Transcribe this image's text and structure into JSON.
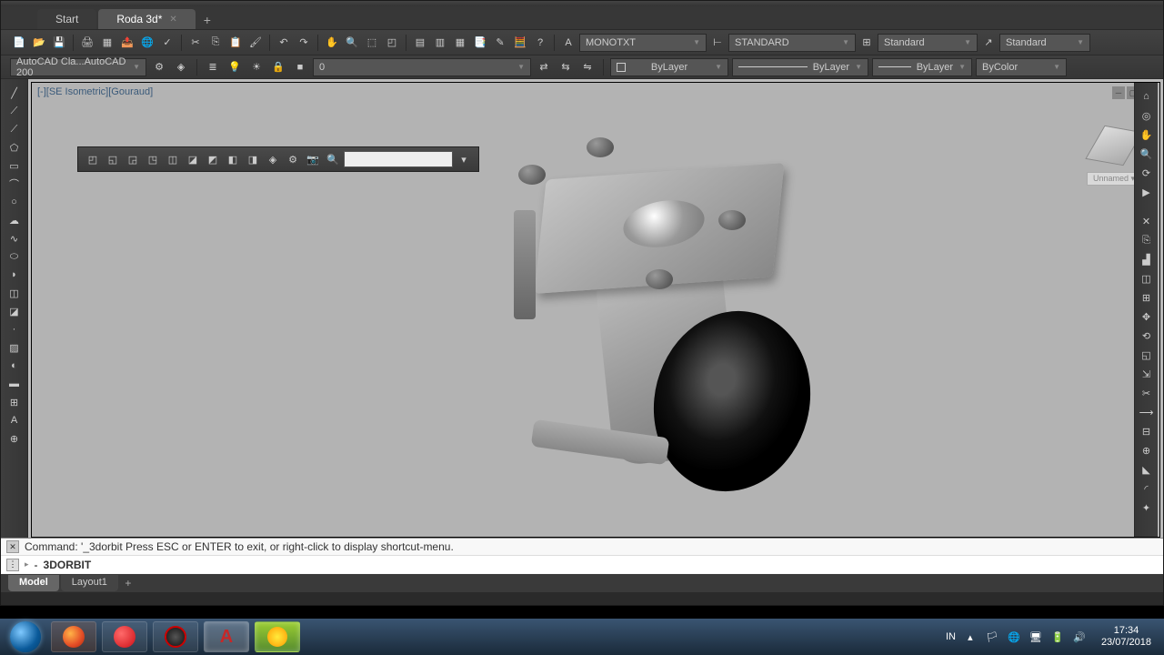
{
  "tabs": {
    "start": "Start",
    "file": "Roda 3d*",
    "add": "+"
  },
  "toolbar_main": {
    "text_style": "MONOTXT",
    "dim_style": "STANDARD",
    "table_style": "Standard",
    "mleader_style": "Standard"
  },
  "toolbar_sub": {
    "workspace": "AutoCAD Cla...AutoCAD 200",
    "layer_name": "0",
    "layer_linetype": "ByLayer",
    "lineweight": "ByLayer",
    "linetype2": "ByLayer",
    "plot_style": "ByColor"
  },
  "viewport": {
    "label": "[-][SE Isometric][Gouraud]",
    "viewcube": "Unnamed"
  },
  "command": {
    "history": "Command: '_3dorbit Press ESC or ENTER to exit, or right-click to display shortcut-menu.",
    "prompt_icon": "▸",
    "prompt_text": "3DORBIT"
  },
  "model_tabs": {
    "model": "Model",
    "layout1": "Layout1",
    "add": "+"
  },
  "tray": {
    "lang": "IN",
    "time": "17:34",
    "date": "23/07/2018"
  }
}
